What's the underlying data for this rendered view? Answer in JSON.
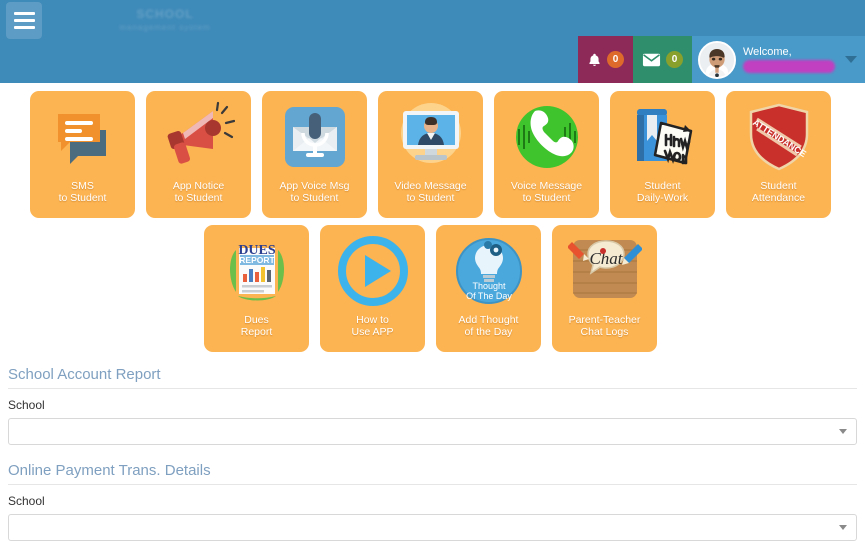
{
  "header": {
    "menu_icon": "hamburger-icon",
    "logo_line1": "SCHOOL",
    "logo_line2": "management system",
    "notifications": {
      "icon": "bell-icon",
      "count": "0"
    },
    "messages": {
      "icon": "envelope-icon",
      "count": "0"
    },
    "user": {
      "welcome_label": "Welcome,",
      "name": "",
      "avatar_icon": "user-avatar",
      "caret_icon": "caret-down-icon"
    }
  },
  "colors": {
    "header_blue": "#3e8ab9",
    "tile_orange": "#fcb351",
    "notif_maroon": "#8e2a58",
    "mail_green": "#2f8f6d",
    "badge_orange": "#dd6a2b",
    "badge_olive": "#8aa02c",
    "section_title_blue": "#7fa0c0",
    "redaction_magenta": "#c13fc1"
  },
  "tiles_row1": [
    {
      "label_line1": "SMS",
      "label_line2": "to Student",
      "icon": "chat-bubbles-icon"
    },
    {
      "label_line1": "App Notice",
      "label_line2": "to Student",
      "icon": "megaphone-icon"
    },
    {
      "label_line1": "App Voice Msg",
      "label_line2": "to Student",
      "icon": "voice-envelope-icon"
    },
    {
      "label_line1": "Video Message",
      "label_line2": "to Student",
      "icon": "video-monitor-icon"
    },
    {
      "label_line1": "Voice Message",
      "label_line2": "to Student",
      "icon": "phone-handset-icon"
    },
    {
      "label_line1": "Student",
      "label_line2": "Daily-Work",
      "icon": "homework-book-icon"
    },
    {
      "label_line1": "Student",
      "label_line2": "Attendance",
      "icon": "attendance-shield-icon"
    }
  ],
  "tiles_row2": [
    {
      "label_line1": "Dues",
      "label_line2": "Report",
      "icon": "dues-report-icon"
    },
    {
      "label_line1": "How to",
      "label_line2": "Use APP",
      "icon": "play-button-icon"
    },
    {
      "label_line1": "Add Thought",
      "label_line2": "of the Day",
      "icon": "lightbulb-thought-icon"
    },
    {
      "label_line1": "Parent-Teacher",
      "label_line2": "Chat Logs",
      "icon": "chat-pencils-icon"
    }
  ],
  "sections": [
    {
      "title": "School Account Report",
      "field_label": "School",
      "select_value": "",
      "select_placeholder": ""
    },
    {
      "title": "Online Payment Trans. Details",
      "field_label": "School",
      "select_value": "",
      "select_placeholder": ""
    }
  ]
}
